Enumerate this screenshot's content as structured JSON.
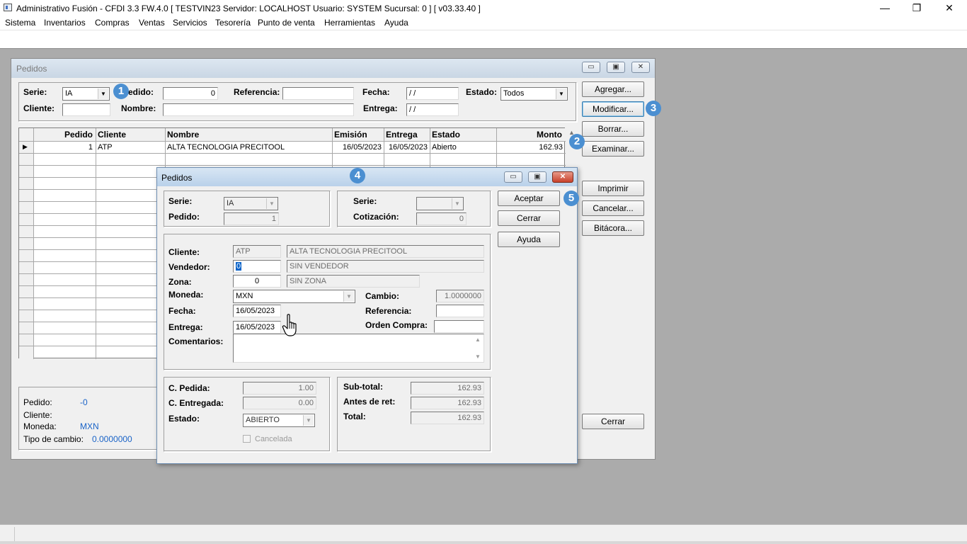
{
  "app": {
    "title": "Administrativo Fusión - CFDI 3.3 FW.4.0 [ TESTVIN23   Servidor: LOCALHOST   Usuario: SYSTEM    Sucursal: 0 ] [ v03.33.40 ]",
    "minimize_glyph": "—",
    "maximize_glyph": "❐",
    "close_glyph": "✕"
  },
  "menu": [
    "Sistema",
    "Inventarios",
    "Compras",
    "Ventas",
    "Servicios",
    "Tesorería",
    "Punto de venta",
    "Herramientas",
    "Ayuda"
  ],
  "pedidos_window": {
    "title": "Pedidos",
    "controls": {
      "minimize": "▭",
      "maximize": "▣",
      "close": "✕"
    },
    "filters": {
      "serie_label": "Serie:",
      "serie_value": "IA",
      "pedido_label": "edido:",
      "pedido_value": "0",
      "referencia_label": "Referencia:",
      "referencia_value": "",
      "fecha_label": "Fecha:",
      "fecha_value": " / /",
      "estado_label": "Estado:",
      "estado_value": "Todos",
      "cliente_label": "Cliente:",
      "cliente_value": "",
      "nombre_label": "Nombre:",
      "nombre_value": "",
      "entrega_label": "Entrega:",
      "entrega_value": " / /"
    },
    "grid": {
      "columns": [
        "Pedido",
        "Cliente",
        "Nombre",
        "Emisión",
        "Entrega",
        "Estado",
        "Monto"
      ],
      "rows": [
        {
          "indicator": "▶",
          "pedido": "1",
          "cliente": "ATP",
          "nombre": "ALTA TECNOLOGIA PRECITOOL",
          "emision": "16/05/2023",
          "entrega": "16/05/2023",
          "estado": "Abierto",
          "monto": "162.93"
        }
      ]
    },
    "buttons": {
      "agregar": "Agregar...",
      "modificar": "Modificar...",
      "borrar": "Borrar...",
      "examinar": "Examinar...",
      "imprimir": "Imprimir",
      "cancelar": "Cancelar...",
      "bitacora": "Bitácora...",
      "cerrar": "Cerrar"
    },
    "info": {
      "pedido_label": "Pedido:",
      "pedido_value": "-0",
      "cliente_label": "Cliente:",
      "cliente_value": "",
      "moneda_label": "Moneda:",
      "moneda_value": "MXN",
      "tipo_cambio_label": "Tipo de cambio:",
      "tipo_cambio_value": "0.0000000"
    }
  },
  "dialog": {
    "title": "Pedidos",
    "controls": {
      "minimize": "▭",
      "maximize": "▣",
      "close": "✕"
    },
    "serie_label": "Serie:",
    "serie_value": "IA",
    "pedido_label": "Pedido:",
    "pedido_value": "1",
    "serie2_label": "Serie:",
    "serie2_value": "",
    "cotizacion_label": "Cotización:",
    "cotizacion_value": "0",
    "cliente_label": "Cliente:",
    "cliente_code": "ATP",
    "cliente_name": "ALTA TECNOLOGIA PRECITOOL",
    "vendedor_label": "Vendedor:",
    "vendedor_code": "0",
    "vendedor_name": "SIN VENDEDOR",
    "zona_label": "Zona:",
    "zona_code": "0",
    "zona_name": "SIN ZONA",
    "moneda_label": "Moneda:",
    "moneda_value": "MXN",
    "cambio_label": "Cambio:",
    "cambio_value": "1.0000000",
    "fecha_label": "Fecha:",
    "fecha_value": "16/05/2023",
    "referencia_label": "Referencia:",
    "referencia_value": "",
    "entrega_label": "Entrega:",
    "entrega_value": "16/05/2023",
    "orden_compra_label": "Orden Compra:",
    "orden_compra_value": "",
    "comentarios_label": "Comentarios:",
    "comentarios_value": "",
    "c_pedida_label": "C. Pedida:",
    "c_pedida_value": "1.00",
    "c_entregada_label": "C. Entregada:",
    "c_entregada_value": "0.00",
    "estado_label": "Estado:",
    "estado_value": "ABIERTO",
    "cancelada_label": "Cancelada",
    "subtotal_label": "Sub-total:",
    "subtotal_value": "162.93",
    "antes_ret_label": "Antes de ret:",
    "antes_ret_value": "162.93",
    "total_label": "Total:",
    "total_value": "162.93",
    "buttons": {
      "aceptar": "Aceptar",
      "cerrar": "Cerrar",
      "ayuda": "Ayuda"
    }
  },
  "badges": [
    "1",
    "2",
    "3",
    "4",
    "5"
  ],
  "colors": {
    "badge": "#4b8fd1",
    "workspace": "#ababab",
    "blue_value": "#1a63c7"
  }
}
